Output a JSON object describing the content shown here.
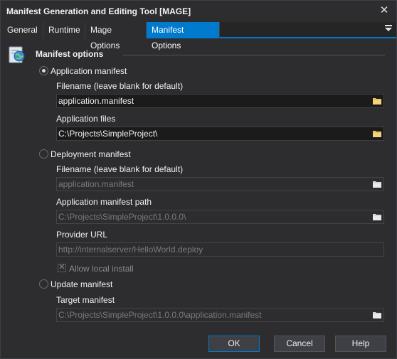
{
  "window": {
    "title": "Manifest Generation and Editing Tool [MAGE]",
    "close_glyph": "✕"
  },
  "tabs": [
    {
      "label": "General",
      "active": false
    },
    {
      "label": "Runtime",
      "active": false
    },
    {
      "label": "Mage Options",
      "active": false
    },
    {
      "label": "Manifest Options",
      "active": true
    }
  ],
  "section": {
    "title": "Manifest options",
    "icon": "manifest-globe-icon"
  },
  "application_manifest": {
    "radio_label": "Application manifest",
    "selected": true,
    "filename_label": "Filename (leave blank for default)",
    "filename_value": "application.manifest",
    "files_label": "Application files",
    "files_value": "C:\\Projects\\SimpleProject\\"
  },
  "deployment_manifest": {
    "radio_label": "Deployment manifest",
    "selected": false,
    "filename_label": "Filename (leave blank for default)",
    "filename_value": "application.manifest",
    "app_manifest_path_label": "Application manifest path",
    "app_manifest_path_value": "C:\\Projects\\SimpleProject\\1.0.0.0\\",
    "provider_url_label": "Provider URL",
    "provider_url_value": "http://internalserver/HelloWorld.deploy",
    "allow_local_install_label": "Allow local install",
    "allow_local_install_checked": true
  },
  "update_manifest": {
    "radio_label": "Update manifest",
    "selected": false,
    "target_label": "Target manifest",
    "target_value": "C:\\Projects\\SimpleProject\\1.0.0.0\\application.manifest"
  },
  "buttons": {
    "ok": "OK",
    "cancel": "Cancel",
    "help": "Help"
  },
  "colors": {
    "accent": "#007acc",
    "background": "#2d2d30",
    "input_background": "#1b1b1c",
    "folder_icon": "#e8c15a"
  }
}
